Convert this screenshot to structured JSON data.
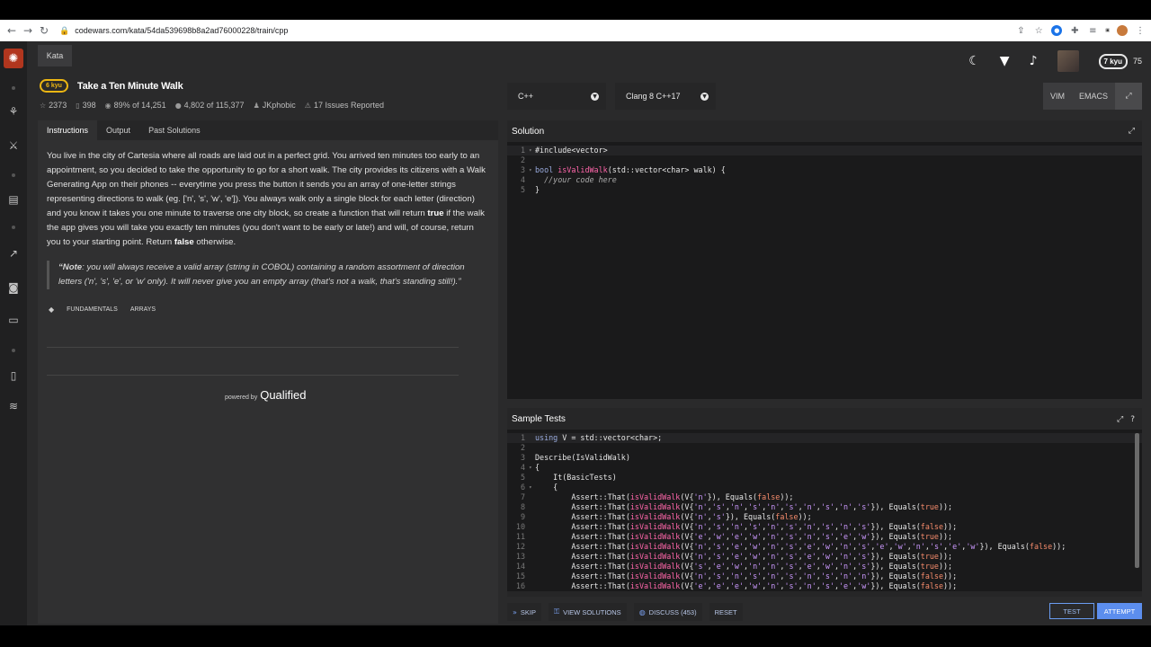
{
  "browser": {
    "url": "codewars.com/kata/54da539698b8a2ad76000228/train/cpp"
  },
  "sidebar": {
    "logo": "codewars-logo"
  },
  "header": {
    "kata_tab": "Kata",
    "rank": "7 kyu",
    "honor": "75"
  },
  "kata": {
    "kyu": "6 kyu",
    "title": "Take a Ten Minute Walk",
    "stats": {
      "votes": "2373",
      "favorites": "398",
      "satisfaction": "89% of 14,251",
      "completed": "4,802 of 115,377",
      "author": "JKphobic",
      "issues": "17 Issues Reported"
    }
  },
  "tabs": [
    "Instructions",
    "Output",
    "Past Solutions"
  ],
  "description": {
    "p1_a": "You live in the city of Cartesia where all roads are laid out in a perfect grid. You arrived ten minutes too early to an appointment, so you decided to take the opportunity to go for a short walk. The city provides its citizens with a Walk Generating App on their phones -- everytime you press the button it sends you an array of one-letter strings representing directions to walk (eg. ['n', 's', 'w', 'e']). You always walk only a single block for each letter (direction) and you know it takes you one minute to traverse one city block, so create a function that will return ",
    "p1_true": "true",
    "p1_b": " if the walk the app gives you will take you exactly ten minutes (you don't want to be early or late!) and will, of course, return you to your starting point. Return ",
    "p1_false": "false",
    "p1_c": " otherwise.",
    "note_label": "“Note",
    "note_text": ": you will always receive a valid array (string in COBOL) containing a random assortment of direction letters ('n', 's', 'e', or 'w' only). It will never give you an empty array (that's not a walk, that's standing still!).”",
    "tags": [
      "FUNDAMENTALS",
      "ARRAYS"
    ],
    "powered_by": "powered by",
    "qualified": "Qualified"
  },
  "editor": {
    "language": "C++",
    "version": "Clang 8 C++17",
    "modes": [
      "VIM",
      "EMACS"
    ],
    "solution_title": "Solution",
    "solution_lines": [
      "#include<vector>",
      "",
      "bool isValidWalk(std::vector<char> walk) {",
      "  //your code here",
      "}"
    ],
    "tests_title": "Sample Tests",
    "test_lines": [
      "using V = std::vector<char>;",
      "",
      "Describe(IsValidWalk)",
      "{",
      "    It(BasicTests)",
      "    {",
      "        Assert::That(isValidWalk(V{'n'}), Equals(false));",
      "        Assert::That(isValidWalk(V{'n','s','n','s','n','s','n','s','n','s'}), Equals(true));",
      "        Assert::That(isValidWalk(V{'n','s'}), Equals(false));",
      "        Assert::That(isValidWalk(V{'n','s','n','s','n','s','n','s','n','s'}), Equals(false));",
      "        Assert::That(isValidWalk(V{'e','w','e','w','n','s','n','s','e','w'}), Equals(true));",
      "        Assert::That(isValidWalk(V{'n','s','e','w','n','s','e','w','n','s','e','w','n','s','e','w'}), Equals(false));",
      "        Assert::That(isValidWalk(V{'n','s','e','w','n','s','e','w','n','s'}), Equals(true));",
      "        Assert::That(isValidWalk(V{'s','e','w','n','n','s','e','w','n','s'}), Equals(true));",
      "        Assert::That(isValidWalk(V{'n','s','n','s','n','s','n','s','n','n'}), Equals(false));",
      "        Assert::That(isValidWalk(V{'e','e','e','w','n','s','n','s','e','w'}), Equals(false));"
    ]
  },
  "actions": {
    "skip": "SKIP",
    "view_solutions": "VIEW SOLUTIONS",
    "discuss": "DISCUSS (453)",
    "reset": "RESET",
    "test": "TEST",
    "attempt": "ATTEMPT"
  },
  "colors": {
    "accent": "#5c8eee",
    "kyu": "#ecb613",
    "brand": "#b1361e"
  }
}
